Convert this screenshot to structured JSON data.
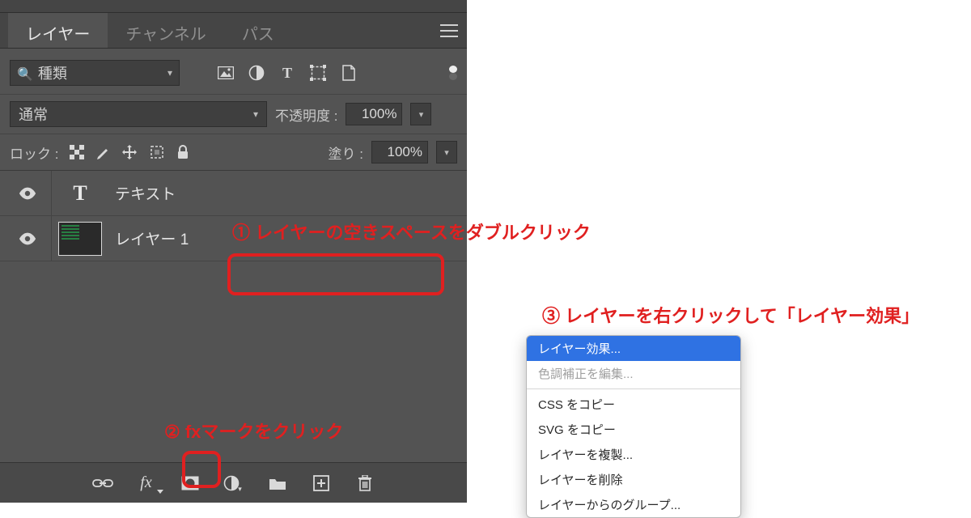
{
  "tabs": {
    "layers": "レイヤー",
    "channels": "チャンネル",
    "paths": "パス"
  },
  "filter": {
    "kind": "種類"
  },
  "blend": {
    "mode": "通常",
    "opacity_label": "不透明度 :",
    "opacity_value": "100%"
  },
  "lock": {
    "label": "ロック :",
    "fill_label": "塗り :",
    "fill_value": "100%"
  },
  "layers": [
    {
      "name": "テキスト",
      "type": "text"
    },
    {
      "name": "レイヤー 1",
      "type": "image"
    }
  ],
  "annotations": {
    "a1": "①  レイヤーの空きスペースをダブルクリック",
    "a2": "②  fxマークをクリック",
    "a3": "③  レイヤーを右クリックして「レイヤー効果」"
  },
  "context_menu": [
    {
      "label": "レイヤー効果...",
      "state": "selected"
    },
    {
      "label": "色調補正を編集...",
      "state": "disabled"
    },
    {
      "sep": true
    },
    {
      "label": "CSS をコピー",
      "state": "normal"
    },
    {
      "label": "SVG をコピー",
      "state": "normal"
    },
    {
      "label": "レイヤーを複製...",
      "state": "normal"
    },
    {
      "label": "レイヤーを削除",
      "state": "normal"
    },
    {
      "label": "レイヤーからのグループ...",
      "state": "normal"
    }
  ]
}
